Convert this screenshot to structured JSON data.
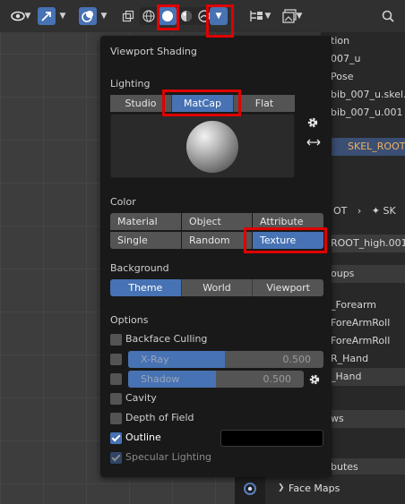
{
  "popup": {
    "title": "Viewport Shading",
    "lighting": {
      "heading": "Lighting",
      "options": [
        "Studio",
        "MatCap",
        "Flat"
      ],
      "selected": "MatCap"
    },
    "color": {
      "heading": "Color",
      "options": [
        "Material",
        "Object",
        "Attribute",
        "Single",
        "Random",
        "Texture"
      ],
      "selected": "Texture"
    },
    "background": {
      "heading": "Background",
      "options": [
        "Theme",
        "World",
        "Viewport"
      ],
      "selected": "Theme"
    },
    "options": {
      "heading": "Options",
      "backface_culling": "Backface Culling",
      "xray_label": "X-Ray",
      "xray_value": "0.500",
      "shadow_label": "Shadow",
      "shadow_value": "0.500",
      "cavity": "Cavity",
      "depth_of_field": "Depth of Field",
      "outline": "Outline",
      "specular_lighting": "Specular Lighting"
    }
  },
  "right_panel": {
    "rows": [
      "tion",
      "007_u",
      "Pose",
      "bib_007_u.skel.0",
      "bib_007_u.001",
      "SKEL_ROOT"
    ],
    "breadcrumb_1": "OT",
    "breadcrumb_2": "SK",
    "mesh_name": "ROOT_high.001",
    "section_groups": "oups",
    "groups": [
      "_Forearm",
      "ForeArmRoll",
      "ForeArmRoll",
      "R_Hand",
      "_Hand"
    ],
    "section_ws": "ws",
    "section_attributes": "butes",
    "face_maps": "Face Maps"
  },
  "colors": {
    "accent": "#4772b3",
    "highlight": "#e00000",
    "selected_text": "#f0b060"
  }
}
